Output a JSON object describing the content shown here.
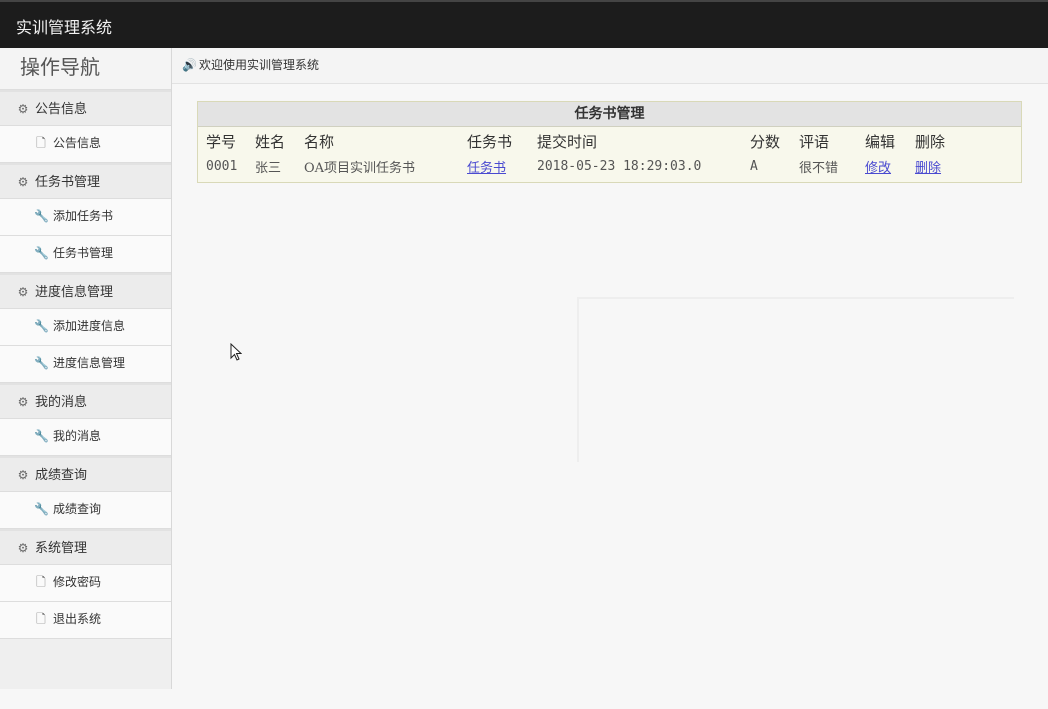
{
  "app": {
    "title": "实训管理系统"
  },
  "sidebar": {
    "title": "操作导航",
    "groups": [
      {
        "label": "公告信息",
        "items": [
          {
            "label": "公告信息"
          }
        ]
      },
      {
        "label": "任务书管理",
        "items": [
          {
            "label": "添加任务书"
          },
          {
            "label": "任务书管理"
          }
        ]
      },
      {
        "label": "进度信息管理",
        "items": [
          {
            "label": "添加进度信息"
          },
          {
            "label": "进度信息管理"
          }
        ]
      },
      {
        "label": "我的消息",
        "items": [
          {
            "label": "我的消息"
          }
        ]
      },
      {
        "label": "成绩查询",
        "items": [
          {
            "label": "成绩查询"
          }
        ]
      },
      {
        "label": "系统管理",
        "items": [
          {
            "label": "修改密码"
          },
          {
            "label": "退出系统"
          }
        ]
      }
    ]
  },
  "welcome": {
    "text": "欢迎使用实训管理系统"
  },
  "task_panel": {
    "title": "任务书管理",
    "columns": [
      "学号",
      "姓名",
      "名称",
      "任务书",
      "提交时间",
      "分数",
      "评语",
      "编辑",
      "删除"
    ],
    "rows": [
      {
        "student_id": "0001",
        "name": "张三",
        "project": "OA项目实训任务书",
        "task_link": "任务书",
        "submitted": "2018-05-23 18:29:03.0",
        "score": "A",
        "comment": "很不错",
        "edit": "修改",
        "delete": "删除"
      }
    ]
  }
}
